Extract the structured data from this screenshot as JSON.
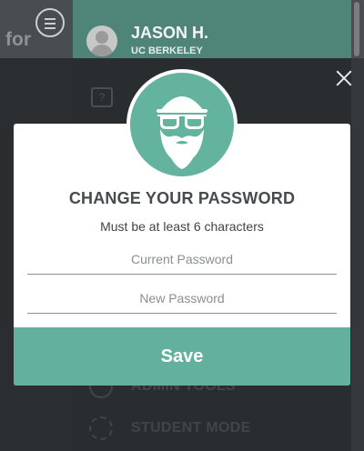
{
  "background": {
    "logo_fragment": "for",
    "user": {
      "name": "JASON H.",
      "school": "UC BERKELEY"
    },
    "help_icon": "?",
    "menu_items": [
      {
        "label": "ADMIN TOOLS",
        "icon": "admin-icon"
      },
      {
        "label": "STUDENT MODE",
        "icon": "refresh-icon"
      }
    ]
  },
  "modal": {
    "title": "CHANGE YOUR PASSWORD",
    "subtitle": "Must be at least 6 characters",
    "current_password": {
      "value": "",
      "placeholder": "Current Password"
    },
    "new_password": {
      "value": "",
      "placeholder": "New Password"
    },
    "save_label": "Save",
    "badge_icon": "bearded-face-sunglasses-icon",
    "close_icon": "close-icon"
  },
  "colors": {
    "accent": "#64b39e",
    "header": "#4f8578",
    "text_dark": "#464b4d"
  }
}
